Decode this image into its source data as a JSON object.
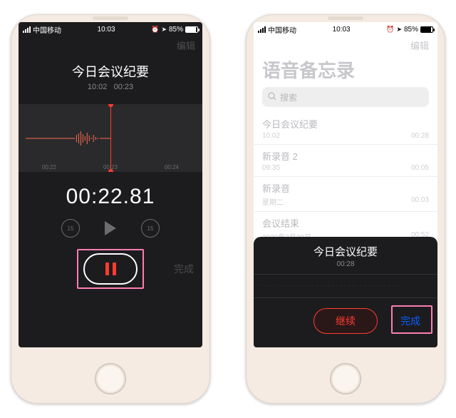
{
  "status": {
    "carrier": "中国移动",
    "time": "10:03",
    "battery": "85%"
  },
  "left": {
    "nav_edit": "编辑",
    "title": "今日会议纪要",
    "subtitle_time": "10:02",
    "subtitle_dur": "00:23",
    "ticks": [
      "00:22",
      "00:23",
      "00:24"
    ],
    "timer": "00:22.81",
    "skip_label": "15",
    "done": "完成"
  },
  "right": {
    "nav_edit": "编辑",
    "big_title": "语音备忘录",
    "search_placeholder": "搜索",
    "items": [
      {
        "name": "今日会议纪要",
        "sub": "10:02",
        "dur": "00:28"
      },
      {
        "name": "新录音 2",
        "sub": "09:35",
        "dur": "00:05"
      },
      {
        "name": "新录音",
        "sub": "星期二",
        "dur": "00:03"
      },
      {
        "name": "会议结束",
        "sub": "2020年3月20日",
        "dur": "00:52"
      }
    ],
    "panel": {
      "title": "今日会议纪要",
      "dur": "00:28",
      "resume": "继续",
      "done": "完成"
    }
  }
}
